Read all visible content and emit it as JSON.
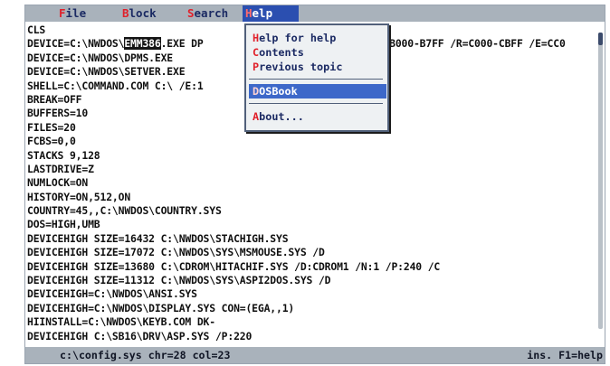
{
  "menubar": {
    "items": [
      {
        "hotkey": "F",
        "rest": "ile"
      },
      {
        "hotkey": "B",
        "rest": "lock"
      },
      {
        "hotkey": "S",
        "rest": "earch"
      },
      {
        "hotkey": "H",
        "rest": "elp"
      }
    ]
  },
  "editor": {
    "line1_pre": "DEVICE=C:\\NWDOS\\",
    "line1_sel": "EMM386",
    "line1_post": ".EXE DP",
    "line1_tail": "/I=B000-B7FF /R=C000-CBFF /E=CC0",
    "line4_main": "SHELL=C:\\COMMAND.COM C:\\ /E:1",
    "lines": [
      "CLS",
      "",
      "DEVICE=C:\\NWDOS\\DPMS.EXE",
      "DEVICE=C:\\NWDOS\\SETVER.EXE",
      "",
      "BREAK=OFF",
      "BUFFERS=10",
      "FILES=20",
      "FCBS=0,0",
      "STACKS 9,128",
      "LASTDRIVE=Z",
      "NUMLOCK=ON",
      "HISTORY=ON,512,ON",
      "COUNTRY=45,,C:\\NWDOS\\COUNTRY.SYS",
      "DOS=HIGH,UMB",
      "DEVICEHIGH SIZE=16432 C:\\NWDOS\\STACHIGH.SYS",
      "DEVICEHIGH SIZE=17072 C:\\NWDOS\\SYS\\MSMOUSE.SYS /D",
      "DEVICEHIGH SIZE=13680 C:\\CDROM\\HITACHIF.SYS /D:CDROM1 /N:1 /P:240 /C",
      "DEVICEHIGH SIZE=11312 C:\\NWDOS\\SYS\\ASPI2DOS.SYS /D",
      "DEVICEHIGH=C:\\NWDOS\\ANSI.SYS",
      "DEVICEHIGH=C:\\NWDOS\\DISPLAY.SYS CON=(EGA,,1)",
      "HIINSTALL=C:\\NWDOS\\KEYB.COM DK-",
      "DEVICEHIGH C:\\SB16\\DRV\\ASP.SYS /P:220"
    ]
  },
  "help_menu": {
    "items": [
      {
        "hotkey": "H",
        "rest": "elp for help"
      },
      {
        "hotkey": "C",
        "rest": "ontents"
      },
      {
        "hotkey": "P",
        "rest": "revious topic"
      },
      {
        "hotkey": "D",
        "rest": "OSBook"
      },
      {
        "hotkey": "A",
        "rest": "bout..."
      }
    ]
  },
  "statusbar": {
    "left": "c:\\config.sys  chr=28 col=23",
    "right": "ins. F1=help"
  }
}
